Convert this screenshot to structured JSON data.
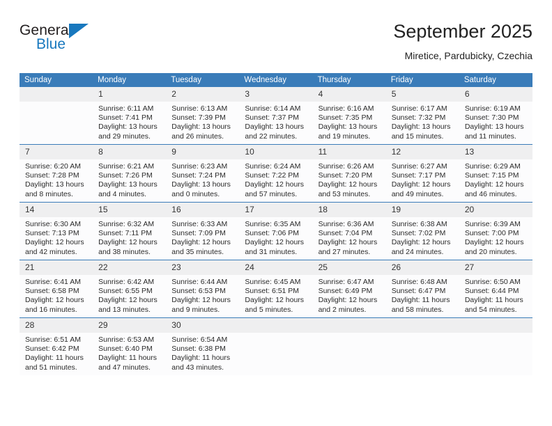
{
  "brand": {
    "name_top": "General",
    "name_bottom": "Blue",
    "triangle_color": "#1878be"
  },
  "header": {
    "title": "September 2025",
    "subtitle": "Miretice, Pardubicky, Czechia"
  },
  "theme": {
    "header_blue": "#3a7cb9",
    "daynum_gray": "#efeff0",
    "cell_background": "#fcfcfd",
    "text": "#222222"
  },
  "weekday_headers": [
    "Sunday",
    "Monday",
    "Tuesday",
    "Wednesday",
    "Thursday",
    "Friday",
    "Saturday"
  ],
  "labels": {
    "sunrise_prefix": "Sunrise:",
    "sunset_prefix": "Sunset:",
    "daylight_prefix": "Daylight:"
  },
  "weeks": [
    [
      {
        "day": "",
        "sunrise": "",
        "sunset": "",
        "daylight": ""
      },
      {
        "day": "1",
        "sunrise": "Sunrise: 6:11 AM",
        "sunset": "Sunset: 7:41 PM",
        "daylight": "Daylight: 13 hours and 29 minutes."
      },
      {
        "day": "2",
        "sunrise": "Sunrise: 6:13 AM",
        "sunset": "Sunset: 7:39 PM",
        "daylight": "Daylight: 13 hours and 26 minutes."
      },
      {
        "day": "3",
        "sunrise": "Sunrise: 6:14 AM",
        "sunset": "Sunset: 7:37 PM",
        "daylight": "Daylight: 13 hours and 22 minutes."
      },
      {
        "day": "4",
        "sunrise": "Sunrise: 6:16 AM",
        "sunset": "Sunset: 7:35 PM",
        "daylight": "Daylight: 13 hours and 19 minutes."
      },
      {
        "day": "5",
        "sunrise": "Sunrise: 6:17 AM",
        "sunset": "Sunset: 7:32 PM",
        "daylight": "Daylight: 13 hours and 15 minutes."
      },
      {
        "day": "6",
        "sunrise": "Sunrise: 6:19 AM",
        "sunset": "Sunset: 7:30 PM",
        "daylight": "Daylight: 13 hours and 11 minutes."
      }
    ],
    [
      {
        "day": "7",
        "sunrise": "Sunrise: 6:20 AM",
        "sunset": "Sunset: 7:28 PM",
        "daylight": "Daylight: 13 hours and 8 minutes."
      },
      {
        "day": "8",
        "sunrise": "Sunrise: 6:21 AM",
        "sunset": "Sunset: 7:26 PM",
        "daylight": "Daylight: 13 hours and 4 minutes."
      },
      {
        "day": "9",
        "sunrise": "Sunrise: 6:23 AM",
        "sunset": "Sunset: 7:24 PM",
        "daylight": "Daylight: 13 hours and 0 minutes."
      },
      {
        "day": "10",
        "sunrise": "Sunrise: 6:24 AM",
        "sunset": "Sunset: 7:22 PM",
        "daylight": "Daylight: 12 hours and 57 minutes."
      },
      {
        "day": "11",
        "sunrise": "Sunrise: 6:26 AM",
        "sunset": "Sunset: 7:20 PM",
        "daylight": "Daylight: 12 hours and 53 minutes."
      },
      {
        "day": "12",
        "sunrise": "Sunrise: 6:27 AM",
        "sunset": "Sunset: 7:17 PM",
        "daylight": "Daylight: 12 hours and 49 minutes."
      },
      {
        "day": "13",
        "sunrise": "Sunrise: 6:29 AM",
        "sunset": "Sunset: 7:15 PM",
        "daylight": "Daylight: 12 hours and 46 minutes."
      }
    ],
    [
      {
        "day": "14",
        "sunrise": "Sunrise: 6:30 AM",
        "sunset": "Sunset: 7:13 PM",
        "daylight": "Daylight: 12 hours and 42 minutes."
      },
      {
        "day": "15",
        "sunrise": "Sunrise: 6:32 AM",
        "sunset": "Sunset: 7:11 PM",
        "daylight": "Daylight: 12 hours and 38 minutes."
      },
      {
        "day": "16",
        "sunrise": "Sunrise: 6:33 AM",
        "sunset": "Sunset: 7:09 PM",
        "daylight": "Daylight: 12 hours and 35 minutes."
      },
      {
        "day": "17",
        "sunrise": "Sunrise: 6:35 AM",
        "sunset": "Sunset: 7:06 PM",
        "daylight": "Daylight: 12 hours and 31 minutes."
      },
      {
        "day": "18",
        "sunrise": "Sunrise: 6:36 AM",
        "sunset": "Sunset: 7:04 PM",
        "daylight": "Daylight: 12 hours and 27 minutes."
      },
      {
        "day": "19",
        "sunrise": "Sunrise: 6:38 AM",
        "sunset": "Sunset: 7:02 PM",
        "daylight": "Daylight: 12 hours and 24 minutes."
      },
      {
        "day": "20",
        "sunrise": "Sunrise: 6:39 AM",
        "sunset": "Sunset: 7:00 PM",
        "daylight": "Daylight: 12 hours and 20 minutes."
      }
    ],
    [
      {
        "day": "21",
        "sunrise": "Sunrise: 6:41 AM",
        "sunset": "Sunset: 6:58 PM",
        "daylight": "Daylight: 12 hours and 16 minutes."
      },
      {
        "day": "22",
        "sunrise": "Sunrise: 6:42 AM",
        "sunset": "Sunset: 6:55 PM",
        "daylight": "Daylight: 12 hours and 13 minutes."
      },
      {
        "day": "23",
        "sunrise": "Sunrise: 6:44 AM",
        "sunset": "Sunset: 6:53 PM",
        "daylight": "Daylight: 12 hours and 9 minutes."
      },
      {
        "day": "24",
        "sunrise": "Sunrise: 6:45 AM",
        "sunset": "Sunset: 6:51 PM",
        "daylight": "Daylight: 12 hours and 5 minutes."
      },
      {
        "day": "25",
        "sunrise": "Sunrise: 6:47 AM",
        "sunset": "Sunset: 6:49 PM",
        "daylight": "Daylight: 12 hours and 2 minutes."
      },
      {
        "day": "26",
        "sunrise": "Sunrise: 6:48 AM",
        "sunset": "Sunset: 6:47 PM",
        "daylight": "Daylight: 11 hours and 58 minutes."
      },
      {
        "day": "27",
        "sunrise": "Sunrise: 6:50 AM",
        "sunset": "Sunset: 6:44 PM",
        "daylight": "Daylight: 11 hours and 54 minutes."
      }
    ],
    [
      {
        "day": "28",
        "sunrise": "Sunrise: 6:51 AM",
        "sunset": "Sunset: 6:42 PM",
        "daylight": "Daylight: 11 hours and 51 minutes."
      },
      {
        "day": "29",
        "sunrise": "Sunrise: 6:53 AM",
        "sunset": "Sunset: 6:40 PM",
        "daylight": "Daylight: 11 hours and 47 minutes."
      },
      {
        "day": "30",
        "sunrise": "Sunrise: 6:54 AM",
        "sunset": "Sunset: 6:38 PM",
        "daylight": "Daylight: 11 hours and 43 minutes."
      },
      {
        "day": "",
        "sunrise": "",
        "sunset": "",
        "daylight": ""
      },
      {
        "day": "",
        "sunrise": "",
        "sunset": "",
        "daylight": ""
      },
      {
        "day": "",
        "sunrise": "",
        "sunset": "",
        "daylight": ""
      },
      {
        "day": "",
        "sunrise": "",
        "sunset": "",
        "daylight": ""
      }
    ]
  ]
}
